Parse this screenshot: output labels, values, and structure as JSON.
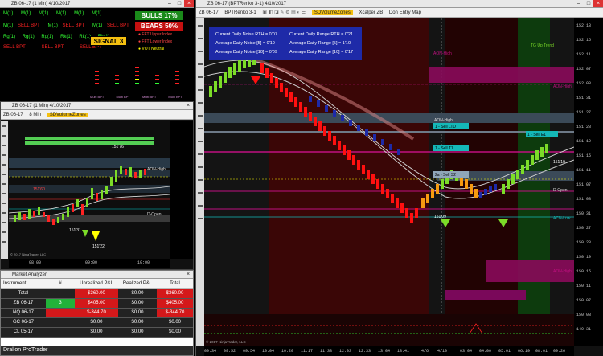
{
  "top_left": {
    "title": "ZB 06-17 (1 Min) 4/10/2017",
    "row1": [
      "M(1)",
      "M(1)",
      "M(1)",
      "M(1)",
      "M(1)",
      "M(1)",
      "M(1)"
    ],
    "row2": [
      "M(1)",
      "SELL BPT",
      "M(1)",
      "SELL BPT",
      "M(1)",
      "SELL BPT"
    ],
    "row3": [
      "Rg(1)",
      "Rg(1)",
      "Rg(1)",
      "Rk(1)",
      "Rk(1)",
      "Rk(1)",
      "Rk(1)"
    ],
    "row4": [
      "SELL BPT",
      "SELL BPT",
      "SELL BPT",
      "SELL BPT"
    ],
    "bulls": "BULLS 17%",
    "bears": "BEARS 50%",
    "signal": "SIGNAL 3",
    "signal_badge": "3",
    "fft_upper": "FFT Upper Index",
    "fft_lower": "FFT Lower Index",
    "vot": "VOT Neutral",
    "multi_labels": [
      "Multi BPT",
      "Multi BPT",
      "Multi BPT",
      "Multi BPT"
    ]
  },
  "mid_left": {
    "title": "ZB 06-17 (1 Min) 4/10/2017",
    "toolbar": [
      "ZB 06-17",
      "8 Min",
      "SDVolumeZones"
    ],
    "labels": {
      "aon_high": "AON-High",
      "d_open": "D-Open",
      "p151_76": "151'76",
      "p151_31": "151'31",
      "p151_22": "151'22",
      "p151_60": "151'60"
    },
    "time_axis": [
      "08:00",
      "09:00",
      "10:00"
    ],
    "copyright": "© 2017 NinjaTrader, LLC"
  },
  "market_analyzer": {
    "title": "Market Analyzer",
    "headers": [
      "Instrument",
      "#",
      "Unrealized P&L",
      "Realized P&L",
      "Total"
    ],
    "rows": [
      [
        "Total",
        "",
        "$360.00",
        "$0.00",
        "$360.00"
      ],
      [
        "ZB 06-17",
        "3",
        "$405.00",
        "$0.00",
        "$405.00"
      ],
      [
        "NQ 06-17",
        "",
        "$-344.70",
        "$0.00",
        "$-344.70"
      ],
      [
        "GC 06-17",
        "",
        "$0.00",
        "$0.00",
        "$0.00"
      ],
      [
        "CL 05-17",
        "",
        "$0.00",
        "$0.00",
        "$0.00"
      ]
    ],
    "footer": "Dralion ProTrader"
  },
  "main_chart": {
    "title": "ZB 06-17 (BPTRenko 3-1) 4/10/2017",
    "toolbar": [
      "ZB 06-17",
      "BPTRenko 3-1",
      "SDVolumeZones",
      "Xcalper ZB",
      "Don Entry Map"
    ],
    "info_box": [
      [
        "Current Daily Noise RTH = 0'07",
        "Current Daily Range RTH = 0'21"
      ],
      [
        "Average Daily Noise [5] = 0'10",
        "Average Daily Range [5] = 1'10"
      ],
      [
        "Average Daily Noise [10] = 0'09",
        "Average Daily Range [10] = 0'17"
      ]
    ],
    "labels": {
      "aon_high_top": "AON-High",
      "tg_up": "TG Up Trend",
      "aon_high_r": "AON-High",
      "aon_high_mid": "AON-High",
      "d_open": "D-Open",
      "aon_low": "ACN-Low",
      "aon_high_low": "AON-High",
      "p151_09": "151'09",
      "p151_19": "151'19",
      "sell_l": "1 - Sell LTD",
      "sell_t": "1 - Sell T1",
      "sell_s2": "2a - Sell S2",
      "sell_e1": "1 - Sell E1"
    },
    "price_axis": [
      "152'18",
      "152'15",
      "152'11",
      "152'07",
      "152'03",
      "151'31",
      "151'27",
      "151'23",
      "151'19",
      "151'15",
      "151'11",
      "151'07",
      "151'03",
      "150'31",
      "150'27",
      "150'23",
      "150'19",
      "150'15",
      "150'11",
      "150'07",
      "150'03",
      "149'31"
    ],
    "time_axis": [
      "09:34",
      "09:52",
      "09:54",
      "10:04",
      "10:20",
      "11:17",
      "11:38",
      "12:03",
      "12:33",
      "13:04",
      "13:41",
      "4/6",
      "4/10",
      "03:04",
      "04:00",
      "05:01",
      "06:19",
      "08:01",
      "09:26"
    ],
    "copyright": "© 2017 NinjaTrader, LLC"
  },
  "colors": {
    "bull": "#7cdc28",
    "bear": "#ff1010",
    "teal": "#14b8b8",
    "magenta": "#c01080",
    "blue": "#1e2aa8"
  }
}
